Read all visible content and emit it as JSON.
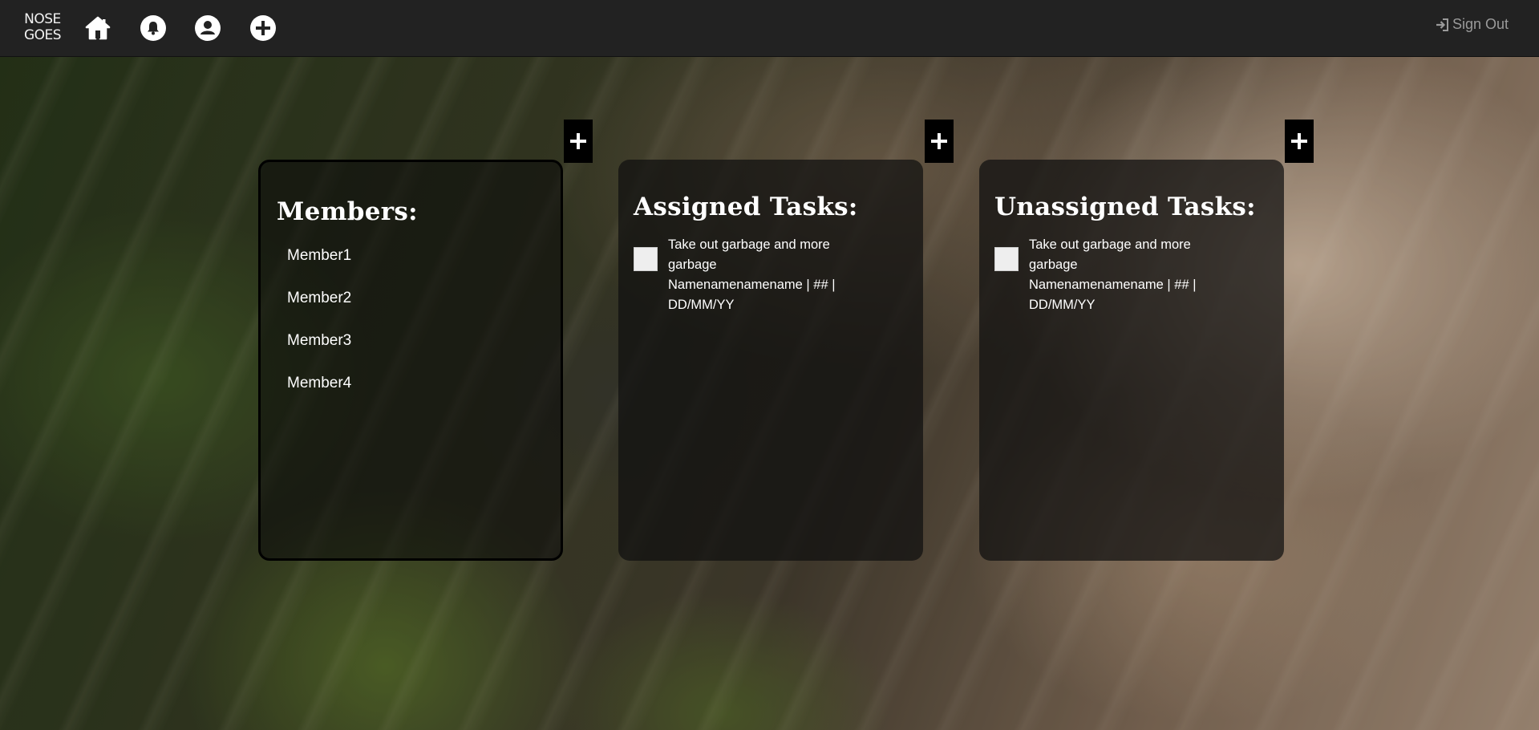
{
  "navbar": {
    "logo_line1": "NOSE",
    "logo_line2": "GOES",
    "sign_out_label": "Sign Out"
  },
  "members_panel": {
    "title": "Members:",
    "members": [
      "Member1",
      "Member2",
      "Member3",
      "Member4"
    ]
  },
  "assigned_panel": {
    "title": "Assigned Tasks:",
    "tasks": [
      {
        "title": "Take out garbage and more garbage",
        "meta": "Namenamenamename | ## | DD/MM/YY"
      }
    ]
  },
  "unassigned_panel": {
    "title": "Unassigned Tasks:",
    "tasks": [
      {
        "title": "Take out garbage and more garbage",
        "meta": "Namenamenamename | ## | DD/MM/YY"
      }
    ]
  },
  "icons": {
    "home": "home-icon",
    "notifications": "bell-icon",
    "profile": "user-icon",
    "create": "plus-circle-icon",
    "add": "plus-icon",
    "sign_out": "sign-in-icon"
  }
}
